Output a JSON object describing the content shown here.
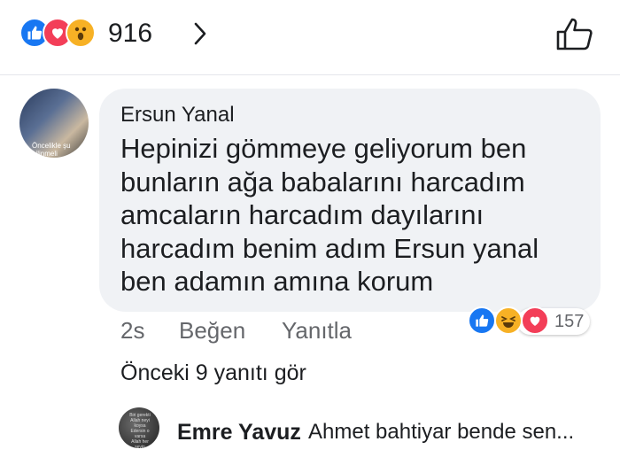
{
  "reactions": {
    "count": "916",
    "icons": [
      "like-icon",
      "love-icon",
      "wow-icon"
    ]
  },
  "comment": {
    "author": "Ersun Yanal",
    "text": "Hepinizi gömmeye geliyorum ben\nbunların ağa babalarını harcadım\namcaların harcadım dayılarını\nharcadım benim adım Ersun yanal\nben adamın amına korum",
    "avatar_caption": "Öncelikle şu bilinmeli\nkişi savunm",
    "time": "2s",
    "like_label": "Beğen",
    "reply_label": "Yanıtla",
    "reaction_count": "157",
    "reaction_icons": [
      "like-icon",
      "haha-icon",
      "love-icon"
    ]
  },
  "view_replies": "Önceki 9 yanıtı gör",
  "reply": {
    "author": "Emre Yavuz",
    "text": "Ahmet bahtiyar bende sen...",
    "avatar_caption": "Biri gerekti\nAllah neyi koysa\nEdersin o varsa\nAllah her şeyin\nHayırlısı\nNasip eder"
  },
  "colors": {
    "like_blue": "#1877f2",
    "love_red": "#f33e58",
    "haha_yellow": "#f7b125",
    "bubble_gray": "#f0f2f5",
    "secondary_text": "#65676b"
  }
}
